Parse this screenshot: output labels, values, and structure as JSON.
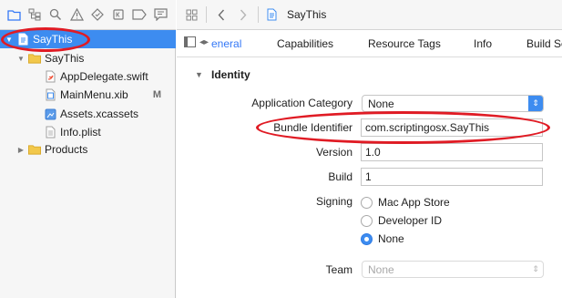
{
  "navigator": {
    "toolbar_icons": [
      "folder-icon",
      "hierarchy-icon",
      "search-icon",
      "warning-icon",
      "test-icon",
      "debug-icon",
      "breakpoint-icon",
      "report-icon"
    ],
    "items": [
      {
        "label": "SayThis",
        "icon": "project-icon",
        "selected": true
      },
      {
        "label": "SayThis",
        "icon": "folder-icon"
      },
      {
        "label": "AppDelegate.swift",
        "icon": "swift-file-icon"
      },
      {
        "label": "MainMenu.xib",
        "icon": "xib-file-icon",
        "badge": "M"
      },
      {
        "label": "Assets.xcassets",
        "icon": "assets-icon"
      },
      {
        "label": "Info.plist",
        "icon": "plist-file-icon"
      },
      {
        "label": "Products",
        "icon": "folder-icon"
      }
    ]
  },
  "jump_bar": {
    "title": "SayThis"
  },
  "tabs": [
    {
      "label": "eneral"
    },
    {
      "label": "Capabilities"
    },
    {
      "label": "Resource Tags"
    },
    {
      "label": "Info"
    },
    {
      "label": "Build Se"
    }
  ],
  "identity": {
    "section_title": "Identity",
    "app_category_label": "Application Category",
    "app_category_value": "None",
    "bundle_id_label": "Bundle Identifier",
    "bundle_id_value": "com.scriptingosx.SayThis",
    "version_label": "Version",
    "version_value": "1.0",
    "build_label": "Build",
    "build_value": "1",
    "signing_label": "Signing",
    "signing_options": [
      {
        "label": "Mac App Store",
        "checked": false
      },
      {
        "label": "Developer ID",
        "checked": false
      },
      {
        "label": "None",
        "checked": true
      }
    ],
    "team_label": "Team",
    "team_value": "None"
  },
  "colors": {
    "selection": "#3d8cf0",
    "annotation": "#e01b24",
    "folder": "#f2c84b"
  }
}
